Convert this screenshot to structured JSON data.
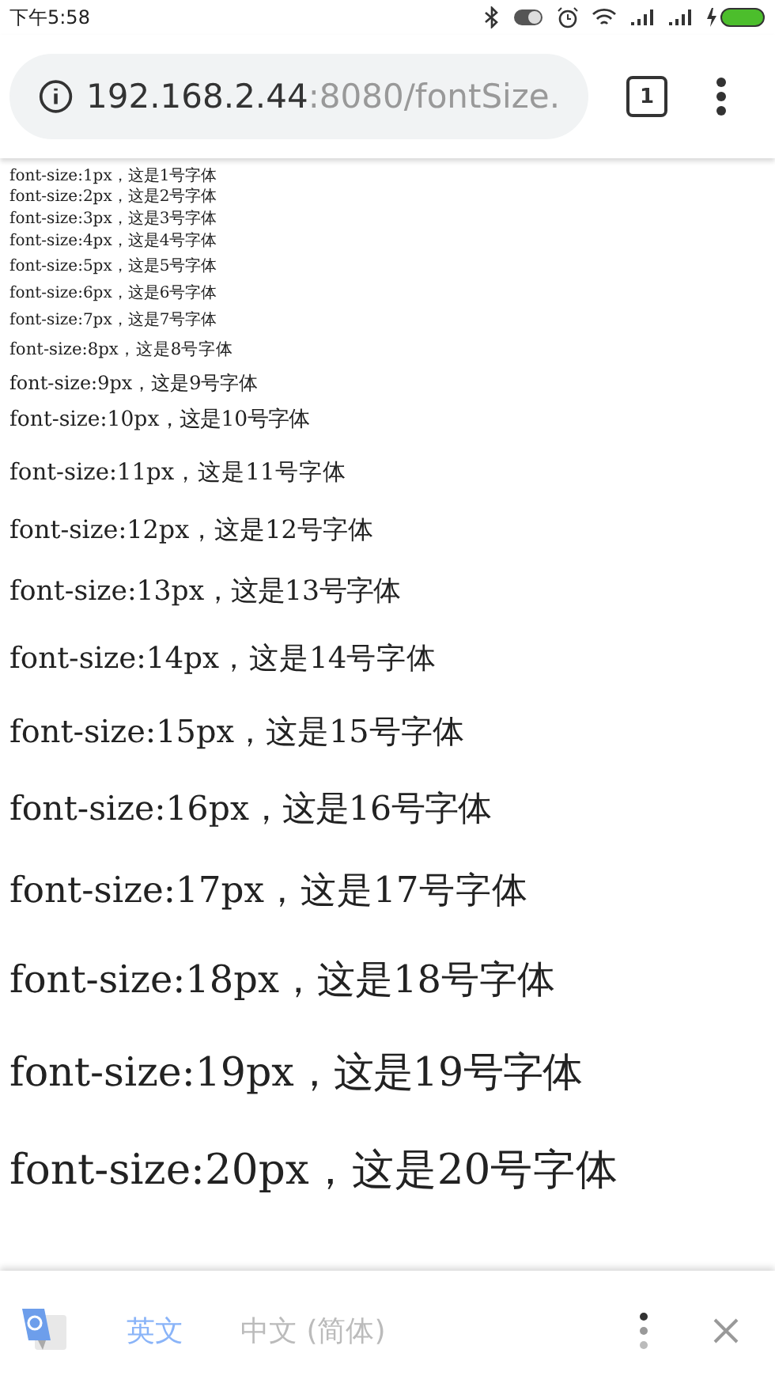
{
  "status_bar": {
    "time": "下午5:58"
  },
  "address_bar": {
    "host": "192.168.2.44",
    "path": ":8080/fontSize.",
    "tab_count": "1"
  },
  "lines": [
    "font-size:1px，这是1号字体",
    "font-size:2px，这是2号字体",
    "font-size:3px，这是3号字体",
    "font-size:4px，这是4号字体",
    "font-size:5px，这是5号字体",
    "font-size:6px，这是6号字体",
    "font-size:7px，这是7号字体",
    "font-size:8px，这是8号字体",
    "font-size:9px，这是9号字体",
    "font-size:10px，这是10号字体",
    "font-size:11px，这是11号字体",
    "font-size:12px，这是12号字体",
    "font-size:13px，这是13号字体",
    "font-size:14px，这是14号字体",
    "font-size:15px，这是15号字体",
    "font-size:16px，这是16号字体",
    "font-size:17px，这是17号字体",
    "font-size:18px，这是18号字体",
    "font-size:19px，这是19号字体",
    "font-size:20px，这是20号字体"
  ],
  "translate_bar": {
    "languages": [
      {
        "label": "英文",
        "selected": true
      },
      {
        "label": "中文 (简体)",
        "selected": false
      }
    ]
  }
}
